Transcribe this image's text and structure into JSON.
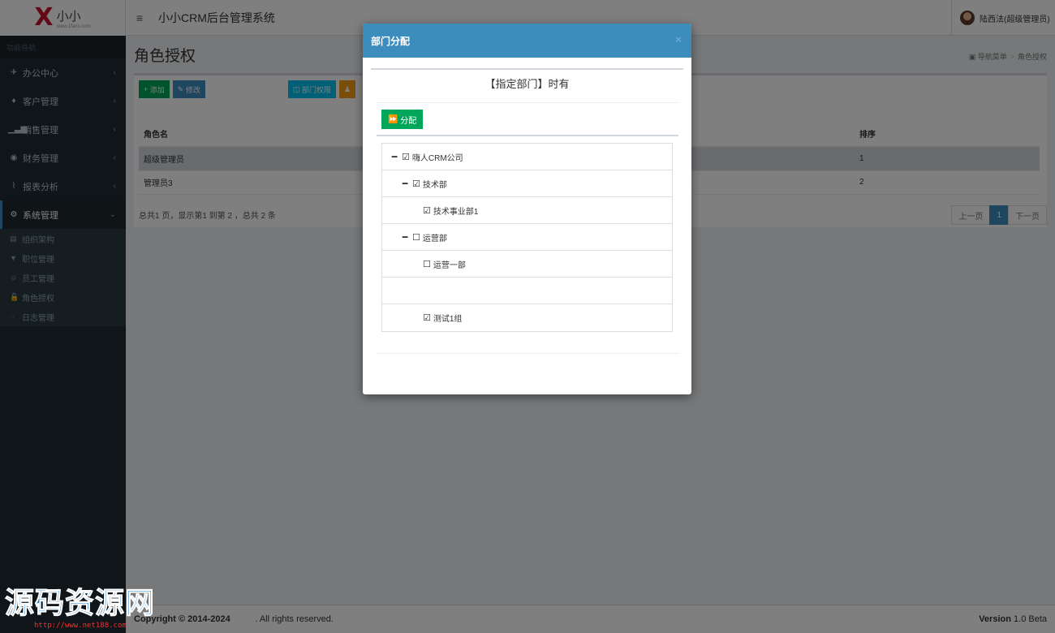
{
  "logo": {
    "mark": "X",
    "title": "小小",
    "sub": "www.1fans.com"
  },
  "sidebar": {
    "header": "功能导航",
    "items": [
      {
        "label": "办公中心",
        "icon": "rocket-icon",
        "glyph": "✈"
      },
      {
        "label": "客户管理",
        "icon": "user-icon",
        "glyph": "♦"
      },
      {
        "label": "销售管理",
        "icon": "bar-chart-icon",
        "glyph": "▁▃▆"
      },
      {
        "label": "财务管理",
        "icon": "coin-icon",
        "glyph": "◉"
      },
      {
        "label": "报表分析",
        "icon": "line-chart-icon",
        "glyph": "⌇"
      },
      {
        "label": "系统管理",
        "icon": "gear-icon",
        "glyph": "⚙"
      }
    ],
    "sub_items": [
      {
        "label": "组织架构",
        "icon": "building-icon",
        "glyph": "▤"
      },
      {
        "label": "职位管理",
        "icon": "bookmark-icon",
        "glyph": "▼"
      },
      {
        "label": "员工管理",
        "icon": "users-icon",
        "glyph": "☺"
      },
      {
        "label": "角色授权",
        "icon": "lock-icon",
        "glyph": "🔓"
      },
      {
        "label": "日志管理",
        "icon": "comment-icon",
        "glyph": "◌"
      }
    ]
  },
  "header": {
    "toggle": "≡",
    "title": "小小CRM后台管理系统",
    "user": "陆西法(超级管理员)"
  },
  "page": {
    "title": "角色授权",
    "breadcrumb": [
      "导航菜单",
      "角色授权"
    ],
    "toolbar": {
      "add": "添加",
      "edit": "修改",
      "dept": "部门权限",
      "extra": ""
    },
    "table": {
      "headers": [
        "角色名",
        "排序"
      ],
      "rows": [
        {
          "name": "超级管理员",
          "order": "1"
        },
        {
          "name": "管理员3",
          "order": "2"
        }
      ]
    },
    "summary": "总共1 页，显示第1 到第 2 ，总共 2 条",
    "pager": {
      "prev": "上一页",
      "current": "1",
      "next": "下一页"
    }
  },
  "modal": {
    "title": "部门分配",
    "close": "×",
    "panel_title": "【指定部门】时有",
    "assign_button": "分配",
    "tree": [
      {
        "label": "嗨人CRM公司",
        "level": 0,
        "expanded": true,
        "checked": true
      },
      {
        "label": "技术部",
        "level": 1,
        "expanded": true,
        "checked": true
      },
      {
        "label": "技术事业部1",
        "level": 2,
        "leaf": true,
        "checked": true
      },
      {
        "label": "运营部",
        "level": 1,
        "expanded": true,
        "checked": false
      },
      {
        "label": "运营一部",
        "level": 2,
        "leaf": true,
        "checked": false
      },
      {
        "label": "",
        "level": 2,
        "leaf": true,
        "blank": true
      },
      {
        "label": "测试1组",
        "level": 2,
        "leaf": true,
        "checked": true
      }
    ]
  },
  "footer": {
    "copyright": "Copyright © 2014-2024",
    "rights": ". All rights reserved.",
    "version_label": "Version",
    "version": "1.0 Beta"
  },
  "watermark": {
    "title": "源码资源网",
    "url": "http://www.net188.com"
  }
}
